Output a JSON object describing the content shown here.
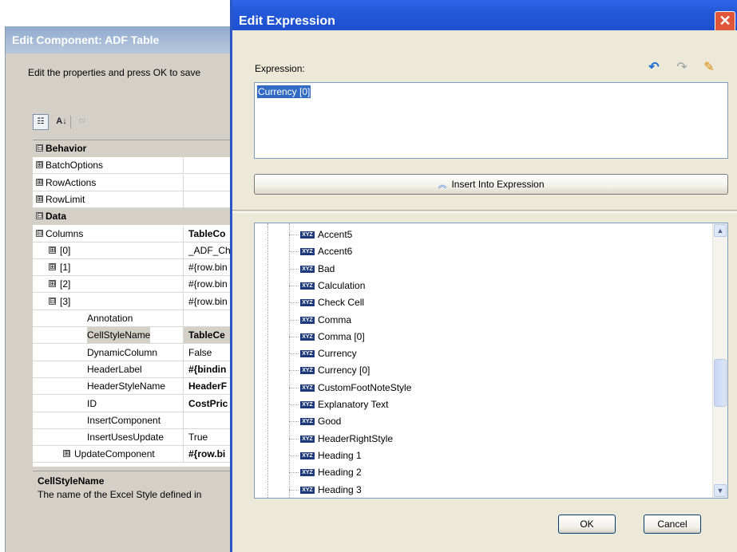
{
  "background_window": {
    "title": "Edit Component: ADF Table",
    "instruction": "Edit the properties and press OK to save",
    "toolbar": {
      "categorized_icon": "categorized-icon",
      "alphabetical_icon": "sort-az-icon",
      "az_label": "A↓",
      "property_pages_icon": "property-pages-icon"
    },
    "rows": [
      {
        "name": "Behavior",
        "value": "",
        "category": true,
        "expander": "⊟"
      },
      {
        "name": "BatchOptions",
        "value": "",
        "expander": "⊞"
      },
      {
        "name": "RowActions",
        "value": "",
        "expander": "⊞"
      },
      {
        "name": "RowLimit",
        "value": "",
        "expander": "⊞"
      },
      {
        "name": "Data",
        "value": "",
        "category": true,
        "expander": "⊟"
      },
      {
        "name": "Columns",
        "value": "TableCo",
        "bold": true,
        "expander": "⊟"
      },
      {
        "name": "[0]",
        "value": "_ADF_Ch",
        "expander": "⊞"
      },
      {
        "name": "[1]",
        "value": "#{row.bin",
        "expander": "⊞"
      },
      {
        "name": "[2]",
        "value": "#{row.bin",
        "expander": "⊞"
      },
      {
        "name": "[3]",
        "value": "#{row.bin",
        "expander": "⊟"
      },
      {
        "name": "Annotation",
        "value": ""
      },
      {
        "name": "CellStyleName",
        "value": "TableCe",
        "bold": true,
        "selected": true
      },
      {
        "name": "DynamicColumn",
        "value": "False"
      },
      {
        "name": "HeaderLabel",
        "value": "#{bindin",
        "bold": true
      },
      {
        "name": "HeaderStyleName",
        "value": "HeaderF",
        "bold": true
      },
      {
        "name": "ID",
        "value": "CostPric",
        "bold": true
      },
      {
        "name": "InsertComponent",
        "value": ""
      },
      {
        "name": "InsertUsesUpdate",
        "value": "True"
      },
      {
        "name": "UpdateComponent",
        "value": "#{row.bi",
        "bold": true,
        "expander": "⊞"
      }
    ],
    "description": {
      "title": "CellStyleName",
      "text": "The name of the Excel Style defined in"
    }
  },
  "dialog": {
    "title": "Edit Expression",
    "close_label": "✕",
    "expression_label": "Expression:",
    "expression_value": "Currency [0]",
    "icons": {
      "undo": "undo-icon",
      "redo": "redo-icon",
      "clear": "eraser-icon"
    },
    "undo_glyph": "↶",
    "redo_glyph": "↷",
    "clear_glyph": "✎",
    "insert_icon": "︽",
    "insert_button": "Insert Into Expression",
    "style_icon_text": "XYZ",
    "tree_items": [
      "Accent5",
      "Accent6",
      "Bad",
      "Calculation",
      "Check Cell",
      "Comma",
      "Comma [0]",
      "Currency",
      "Currency [0]",
      "CustomFootNoteStyle",
      "Explanatory Text",
      "Good",
      "HeaderRightStyle",
      "Heading 1",
      "Heading 2",
      "Heading 3"
    ],
    "scroll_up": "▲",
    "scroll_down": "▼",
    "ok_button": "OK",
    "cancel_button": "Cancel"
  }
}
